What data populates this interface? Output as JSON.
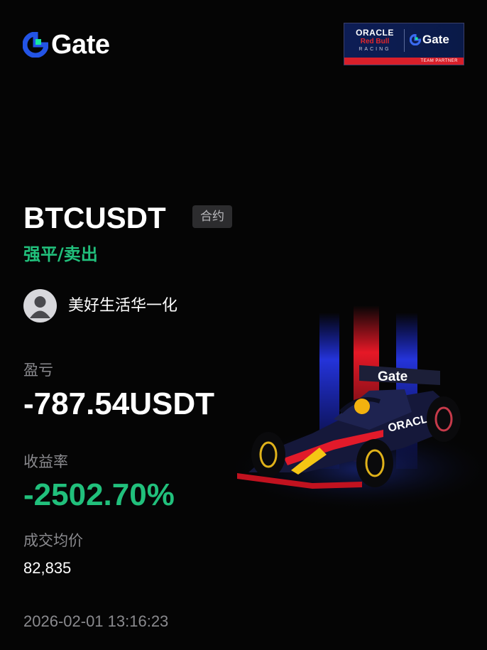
{
  "header": {
    "logo_text": "Gate",
    "badge": {
      "oracle": "ORACLE",
      "redbull": "Red Bull",
      "racing": "RACING",
      "gate": "Gate",
      "partner": "TEAM PARTNER"
    }
  },
  "trade": {
    "symbol": "BTCUSDT",
    "type_tag": "合约",
    "side": "强平/卖出"
  },
  "user": {
    "name": "美好生活华一化",
    "avatar_icon": "default-user-avatar"
  },
  "stats": {
    "pnl_label": "盈亏",
    "pnl_value": "-787.54USDT",
    "roi_label": "收益率",
    "roi_value": "-2502.70%",
    "avg_price_label": "成交均价",
    "avg_price_value": "82,835"
  },
  "timestamp": "2026-02-01 13:16:23",
  "car": {
    "livery_text": "Gate",
    "sponsor_text": "ORACLE"
  },
  "colors": {
    "background": "#050505",
    "positive_green": "#21c07c",
    "muted_gray": "#8a8a8e",
    "brand_blue": "#2354e6",
    "brand_green": "#17e6a1"
  }
}
